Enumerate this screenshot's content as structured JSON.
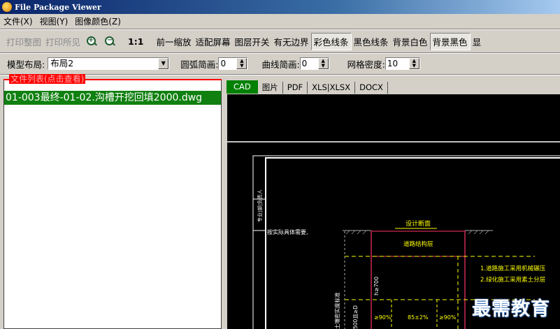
{
  "window": {
    "title": "File Package Viewer"
  },
  "menu": {
    "items": [
      "文件(X)",
      "视图(Y)",
      "图像颜色(Z)"
    ]
  },
  "toolbar": {
    "print_all": "打印整图",
    "print_visible": "打印所见",
    "scale_1_1": "1:1",
    "prev_zoom": "前一缩放",
    "fit_screen": "适配屏幕",
    "layer_switch": "图层开关",
    "with_border": "有无边界",
    "color_lines": "彩色线条",
    "black_lines": "黑色线条",
    "bg_white": "背景白色",
    "bg_black": "背景黑色",
    "more": "显"
  },
  "options": {
    "model_layout_label": "模型布局:",
    "model_layout_value": "布局2",
    "arc_simplify_label": "圆弧简画:",
    "arc_simplify_value": "0",
    "curve_simplify_label": "曲线简画:",
    "curve_simplify_value": "0",
    "grid_density_label": "网格密度:",
    "grid_density_value": "10"
  },
  "file_list": {
    "header": "文件列表(点击查看)",
    "items": [
      "01-003最终-01-02.沟槽开挖回填2000.dwg"
    ]
  },
  "tabs": [
    "CAD",
    "图片",
    "PDF",
    "XLS|XLSX",
    "DOCX"
  ],
  "drawing": {
    "side_label": "专业|部|负责人",
    "title_design": "设计断面",
    "road_layer": "道路结构层",
    "left_note": "按实际具体需要,",
    "vertical_label": "h≥700",
    "left_col1": "土壤密实度标准",
    "left_col2": "500且≥D",
    "pct_left": "≥90%",
    "pct_mid": "85±2%",
    "pct_right": "≥90%",
    "note1": "1.道路施工采用机械碾压",
    "note2": "2.绿化施工采用素土分层"
  },
  "watermark": "最需教育"
}
